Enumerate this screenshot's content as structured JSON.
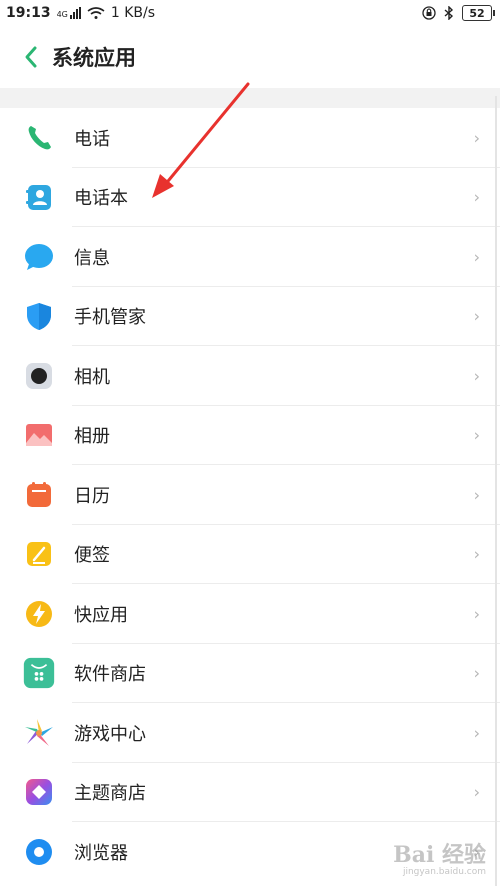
{
  "status_bar": {
    "time": "19:13",
    "network": "4G",
    "speed": "1 KB/s",
    "battery": "52"
  },
  "header": {
    "title": "系统应用",
    "back_icon": "chevron-left-icon"
  },
  "apps": [
    {
      "label": "电话",
      "icon": "phone-icon"
    },
    {
      "label": "电话本",
      "icon": "contacts-icon"
    },
    {
      "label": "信息",
      "icon": "message-icon"
    },
    {
      "label": "手机管家",
      "icon": "shield-icon"
    },
    {
      "label": "相机",
      "icon": "camera-icon"
    },
    {
      "label": "相册",
      "icon": "gallery-icon"
    },
    {
      "label": "日历",
      "icon": "calendar-icon"
    },
    {
      "label": "便签",
      "icon": "notes-icon"
    },
    {
      "label": "快应用",
      "icon": "quick-app-icon"
    },
    {
      "label": "软件商店",
      "icon": "app-store-icon"
    },
    {
      "label": "游戏中心",
      "icon": "game-center-icon"
    },
    {
      "label": "主题商店",
      "icon": "theme-store-icon"
    },
    {
      "label": "浏览器",
      "icon": "browser-icon"
    }
  ],
  "chevron": "›",
  "watermark": {
    "brand": "Bai 经验",
    "url": "jingyan.baidu.com"
  },
  "colors": {
    "accent": "#2bb673",
    "annotation": "#e8322e"
  }
}
